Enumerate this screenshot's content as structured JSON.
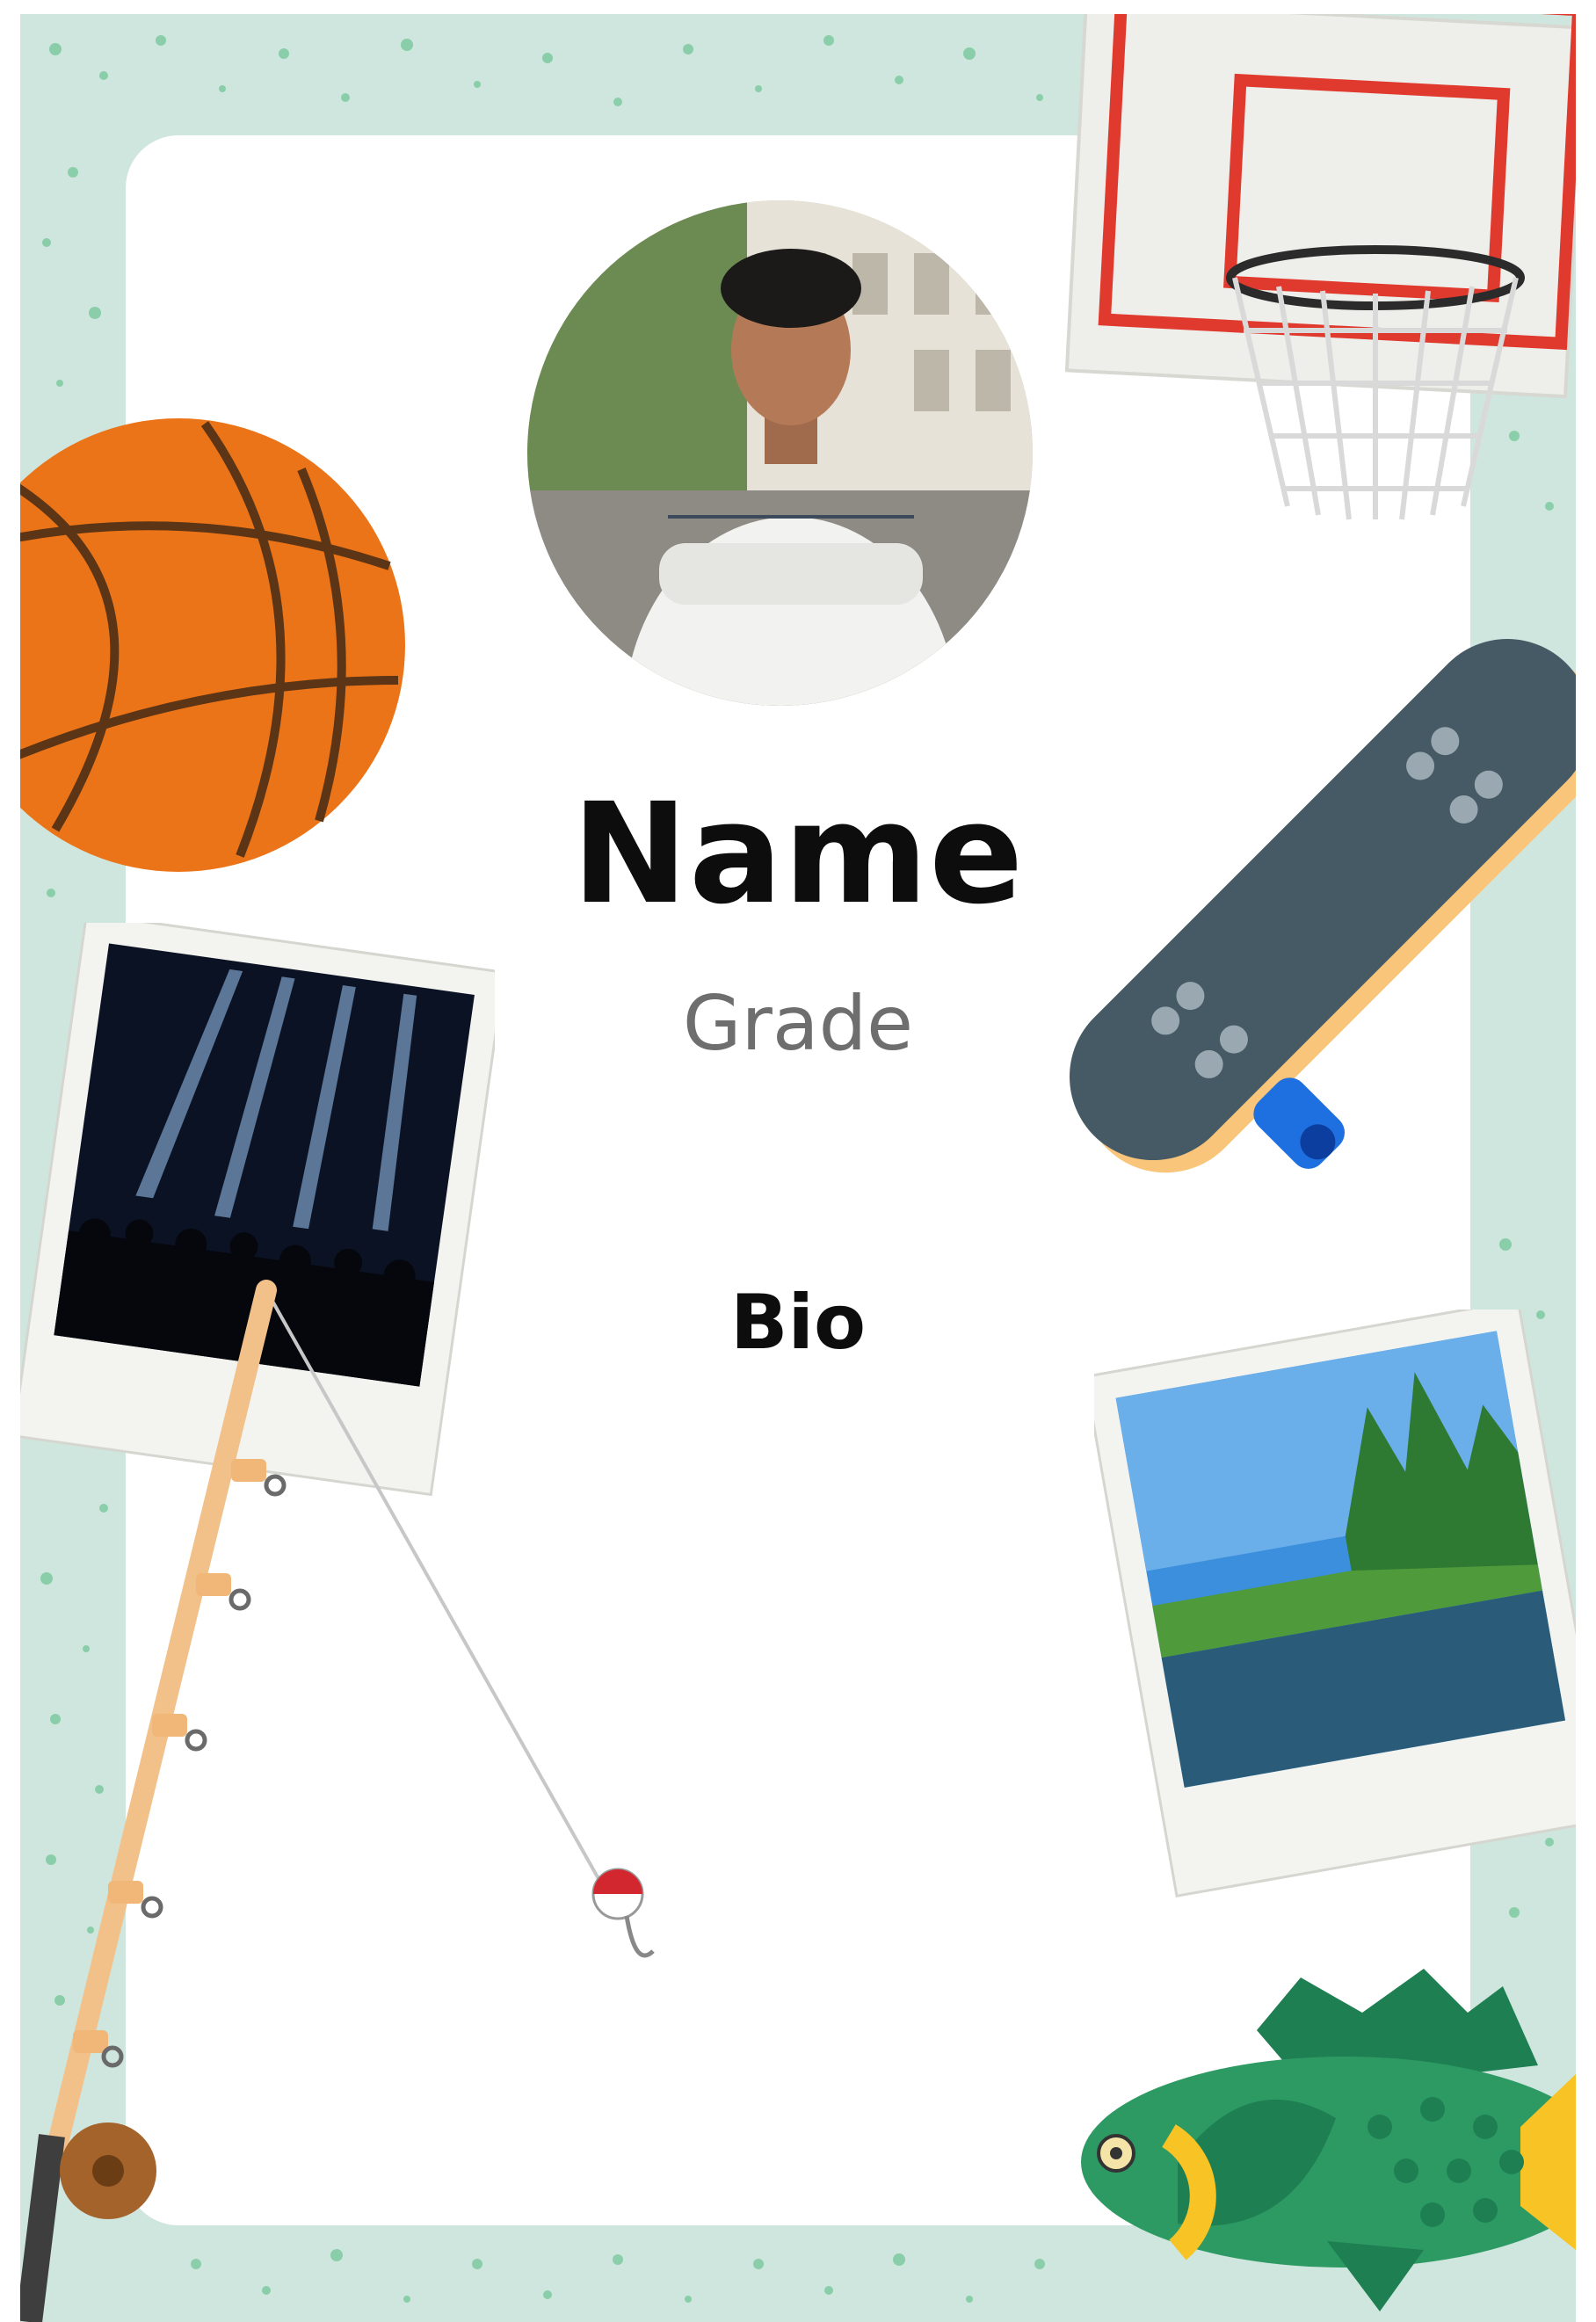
{
  "profile": {
    "name": "Name",
    "grade": "Grade",
    "bio": "Bio"
  },
  "colors": {
    "frame_background": "#cfe6de",
    "speckle": "#7ecaa0",
    "card": "#ffffff",
    "name_text": "#0d0d0d",
    "grade_text": "#6e6e6e"
  },
  "decorations": [
    "basketball-icon",
    "basketball-hoop-icon",
    "skateboard-icon",
    "concert-photo",
    "lake-photo",
    "fishing-rod-icon",
    "fish-icon",
    "student-portrait-photo"
  ]
}
